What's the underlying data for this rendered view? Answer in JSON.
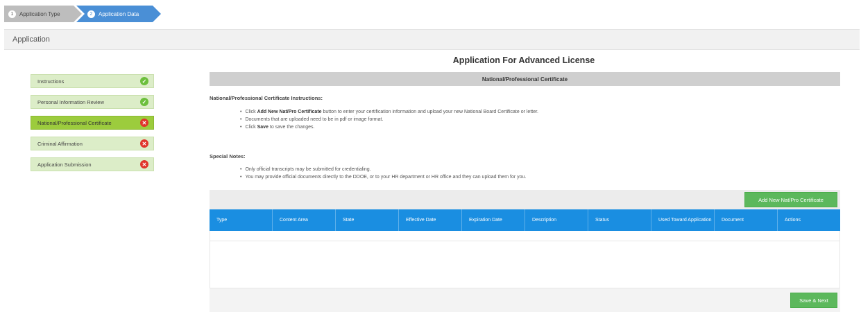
{
  "wizard": {
    "steps": [
      {
        "num": "1",
        "label": "Application Type"
      },
      {
        "num": "2",
        "label": "Application Data"
      }
    ]
  },
  "section_title": "Application",
  "page_title": "Application For Advanced License",
  "sidebar": {
    "items": [
      {
        "label": "Instructions",
        "status": "complete"
      },
      {
        "label": "Personal Information Review",
        "status": "complete"
      },
      {
        "label": "National/Professional Certificate",
        "status": "incomplete",
        "active": true
      },
      {
        "label": "Criminal Affirmation",
        "status": "incomplete"
      },
      {
        "label": "Application Submission",
        "status": "incomplete"
      }
    ]
  },
  "panel": {
    "header": "National/Professional Certificate",
    "instructions_title": "National/Professional Certificate Instructions:",
    "instructions": {
      "i1_pre": "Click ",
      "i1_bold": "Add New Nat/Pro Certificate",
      "i1_post": " button to enter your certification information and upload your new National Board Certificate or letter.",
      "i2": "Documents that are uploaded need to be in pdf or image format.",
      "i3_pre": "Click ",
      "i3_bold": "Save",
      "i3_post": " to save the changes."
    },
    "notes_title": "Special Notes:",
    "notes": [
      "Only official transcripts may be submitted for credentialing.",
      "You may provide official documents directly to the DDOE, or to your HR department or HR office and they can upload them for you."
    ],
    "add_button": "Add New Nat/Pro Certificate",
    "table": {
      "columns": [
        "Type",
        "Content Area",
        "State",
        "Effective Date",
        "Expiration Date",
        "Description",
        "Status",
        "Used Toward Application",
        "Document",
        "Actions"
      ]
    },
    "save_button": "Save & Next"
  },
  "colors": {
    "accent_blue": "#1a8ee1",
    "green": "#5cb85c",
    "step_active": "#9ccc3d",
    "step_bg": "#dcedc8",
    "error_red": "#e0352b"
  }
}
